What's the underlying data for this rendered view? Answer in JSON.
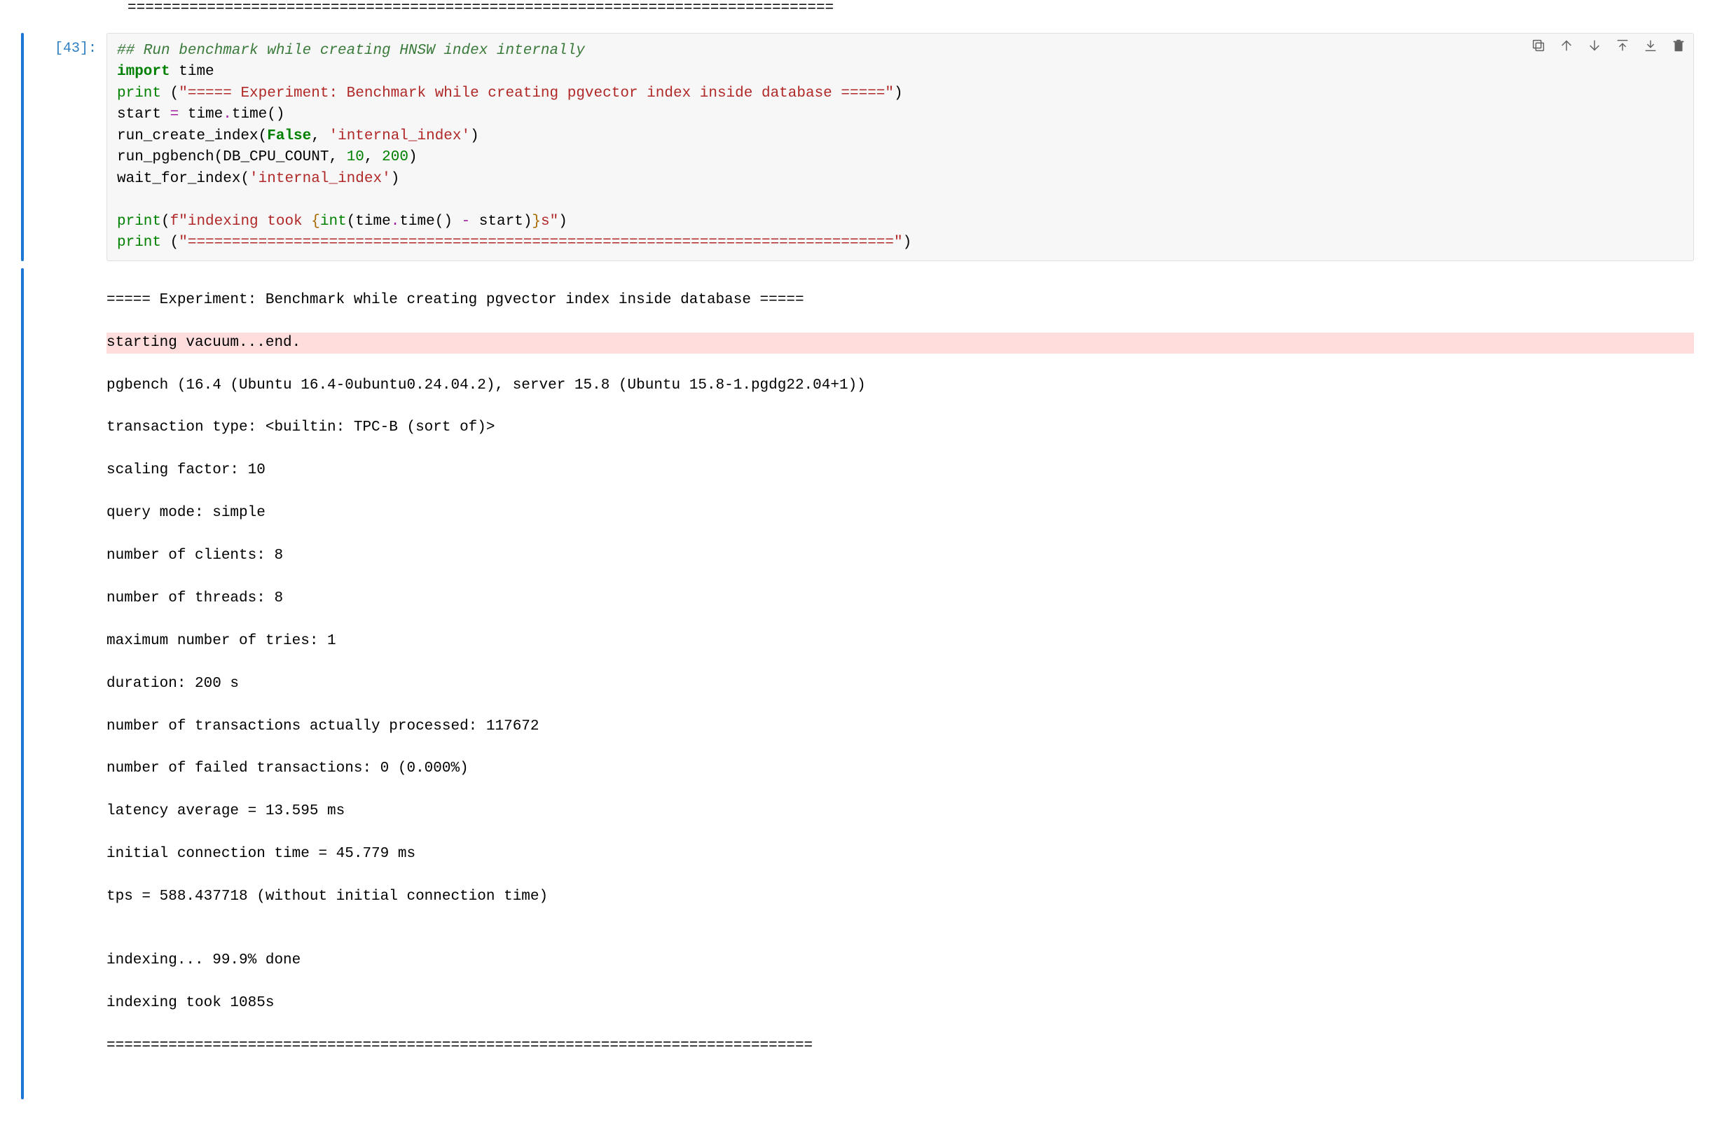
{
  "divider_top": "================================================================================",
  "prompt": "[43]:",
  "code": {
    "comment": "## Run benchmark while creating HNSW index internally",
    "import_kw": "import",
    "import_mod": "time",
    "print_kw": "print",
    "str_exp_header": "\"===== Experiment: Benchmark while creating pgvector index inside database =====\"",
    "start_var": "start",
    "eq": "=",
    "time_mod": "time",
    "dot": ".",
    "time_fn": "time",
    "parens": "()",
    "run_create_index": "run_create_index",
    "false_kw": "False",
    "comma": ",",
    "str_internal": "'internal_index'",
    "run_pgbench": "run_pgbench",
    "db_cpu": "DB_CPU_COUNT",
    "n10": "10",
    "n200": "200",
    "wait_for_index": "wait_for_index",
    "f_prefix": "f",
    "fstr_open": "\"indexing took ",
    "brace_open": "{",
    "int_fn": "int",
    "minus": "-",
    "brace_close": "}",
    "fstr_close": "s\"",
    "str_rule": "\"================================================================================\""
  },
  "output": {
    "line0": "===== Experiment: Benchmark while creating pgvector index inside database =====",
    "stderr": "starting vacuum...end.",
    "line1": "pgbench (16.4 (Ubuntu 16.4-0ubuntu0.24.04.2), server 15.8 (Ubuntu 15.8-1.pgdg22.04+1))",
    "line2": "transaction type: <builtin: TPC-B (sort of)>",
    "line3": "scaling factor: 10",
    "line4": "query mode: simple",
    "line5": "number of clients: 8",
    "line6": "number of threads: 8",
    "line7": "maximum number of tries: 1",
    "line8": "duration: 200 s",
    "line9": "number of transactions actually processed: 117672",
    "line10": "number of failed transactions: 0 (0.000%)",
    "line11": "latency average = 13.595 ms",
    "line12": "initial connection time = 45.779 ms",
    "line13": "tps = 588.437718 (without initial connection time)",
    "blank": "",
    "line14": "indexing... 99.9% done",
    "line15": "indexing took 1085s",
    "line16": "================================================================================"
  }
}
